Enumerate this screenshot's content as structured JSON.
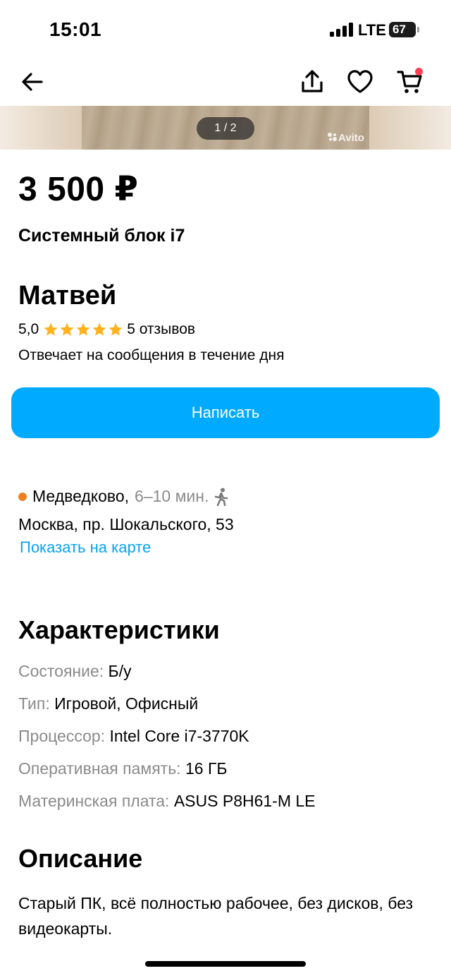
{
  "status_bar": {
    "time": "15:01",
    "network": "LTE",
    "battery": "67"
  },
  "nav": {
    "back_icon": "arrow-left-icon",
    "share_icon": "share-icon",
    "favorite_icon": "heart-icon",
    "cart_icon": "cart-icon"
  },
  "gallery": {
    "counter": "1 / 2",
    "watermark": "Avito"
  },
  "listing": {
    "price": "3 500 ₽",
    "title": "Системный блок i7"
  },
  "seller": {
    "name": "Матвей",
    "rating": "5,0",
    "stars": 5,
    "reviews": "5 отзывов",
    "response_time": "Отвечает на сообщения в течение дня"
  },
  "actions": {
    "write_label": "Написать"
  },
  "location": {
    "metro": "Медведково,",
    "walk_time": "6–10 мин.",
    "metro_color": "#f0801e",
    "address": "Москва, пр. Шокальского, 53",
    "map_link": "Показать на карте"
  },
  "specs": {
    "title": "Характеристики",
    "items": [
      {
        "label": "Состояние:",
        "value": "Б/у"
      },
      {
        "label": "Тип:",
        "value": "Игровой, Офисный"
      },
      {
        "label": "Процессор:",
        "value": "Intel Core i7-3770K"
      },
      {
        "label": "Оперативная память:",
        "value": "16 ГБ"
      },
      {
        "label": "Материнская плата:",
        "value": "ASUS P8H61-M LE"
      }
    ]
  },
  "description": {
    "title": "Описание",
    "text": "Старый ПК, всё полностью рабочее, без дисков, без видеокарты."
  },
  "colors": {
    "accent": "#00aaff",
    "link": "#0aa3f0",
    "cart_badge": "#ff4053",
    "star": "#ffb21e"
  }
}
